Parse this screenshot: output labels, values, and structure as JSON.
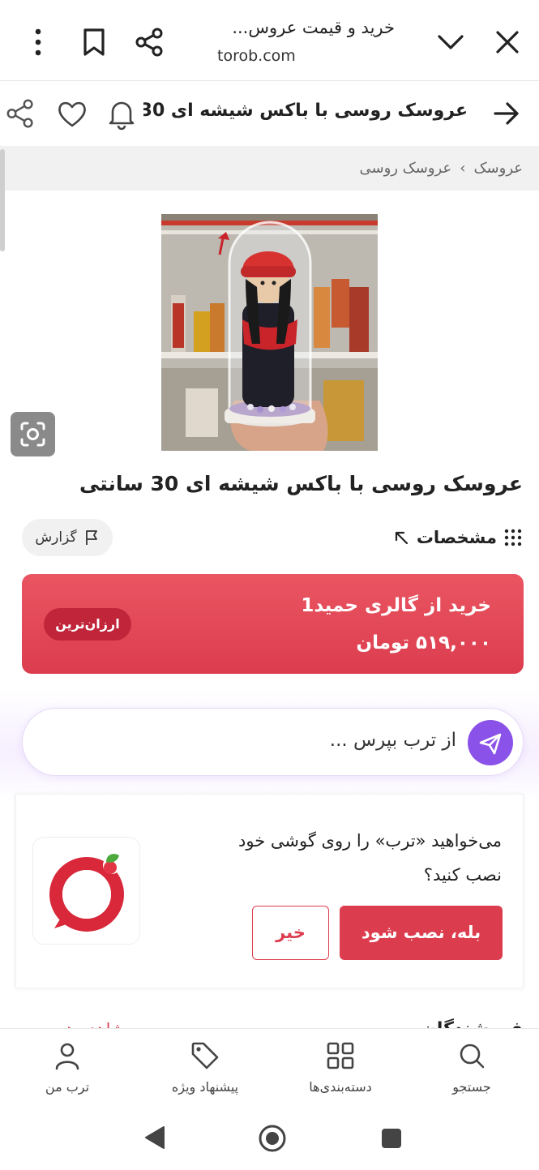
{
  "browser": {
    "title": "خرید و قیمت عروس...",
    "url": "torob.com",
    "icons": [
      "close-icon",
      "chevron-down-icon",
      "share-icon",
      "bookmark-icon",
      "more-vertical-icon"
    ]
  },
  "header": {
    "title": "عروسک روسی با باکس شیشه ای 30...",
    "icons": [
      "arrow-right-icon",
      "bell-icon",
      "heart-icon",
      "share-icon"
    ]
  },
  "breadcrumb": {
    "items": [
      "عروسک",
      "عروسک روسی"
    ],
    "separator": "›"
  },
  "product": {
    "title": "عروسک روسی با باکس شیشه ای 30 سانتی",
    "specs_label": "مشخصات",
    "report_label": "گزارش"
  },
  "buy_card": {
    "store": "خرید از گالری حمید1",
    "price": "۵۱۹,۰۰۰ تومان",
    "badge": "ارزان‌ترین"
  },
  "ask": {
    "placeholder": "از ترب بپرس ..."
  },
  "install_prompt": {
    "line1": "می‌خواهید «ترب» را روی گوشی خود",
    "line2": "نصب کنید؟",
    "yes_label": "بله، نصب شود",
    "no_label": "خیر"
  },
  "peek_section": {
    "heading": "فروشندگان",
    "link": "مشاهده همه"
  },
  "bottom_nav": {
    "items": [
      {
        "label": "جستجو",
        "icon": "search-icon"
      },
      {
        "label": "دسته‌بندی‌ها",
        "icon": "grid-icon"
      },
      {
        "label": "پیشنهاد ویژه",
        "icon": "tag-icon"
      },
      {
        "label": "ترب من",
        "icon": "user-icon"
      }
    ]
  },
  "colors": {
    "brand_red": "#dc3d4e",
    "ask_purple": "#8a52e8"
  }
}
